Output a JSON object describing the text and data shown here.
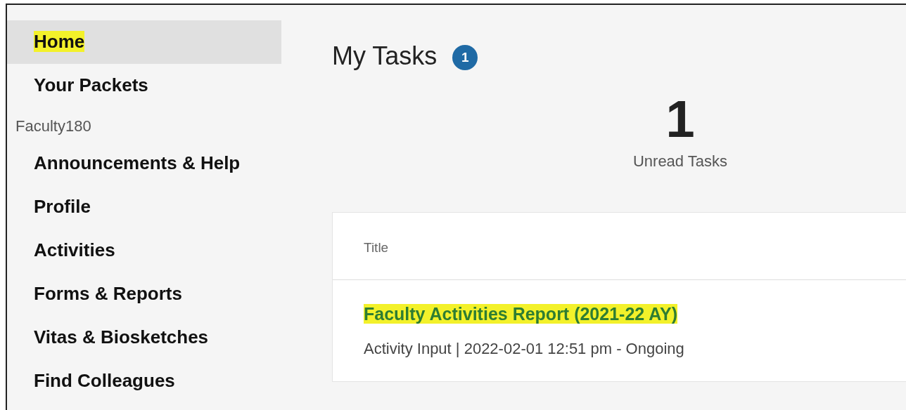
{
  "sidebar": {
    "items": [
      {
        "kind": "link",
        "label": "Home",
        "selected": true,
        "highlighted": true
      },
      {
        "kind": "link",
        "label": "Your Packets",
        "selected": false,
        "highlighted": false
      },
      {
        "kind": "header",
        "label": "Faculty180"
      },
      {
        "kind": "link",
        "label": "Announcements & Help",
        "selected": false,
        "highlighted": false
      },
      {
        "kind": "link",
        "label": "Profile",
        "selected": false,
        "highlighted": false
      },
      {
        "kind": "link",
        "label": "Activities",
        "selected": false,
        "highlighted": false
      },
      {
        "kind": "link",
        "label": "Forms & Reports",
        "selected": false,
        "highlighted": false
      },
      {
        "kind": "link",
        "label": "Vitas & Biosketches",
        "selected": false,
        "highlighted": false
      },
      {
        "kind": "link",
        "label": "Find Colleagues",
        "selected": false,
        "highlighted": false
      }
    ]
  },
  "main": {
    "title": "My Tasks",
    "badge": "1",
    "count": "1",
    "count_label": "Unread Tasks",
    "table": {
      "columns": [
        "Title"
      ],
      "rows": [
        {
          "title": "Faculty Activities Report (2021-22 AY)",
          "highlighted": true,
          "meta": "Activity Input | 2022-02-01 12:51 pm - Ongoing"
        }
      ]
    }
  }
}
